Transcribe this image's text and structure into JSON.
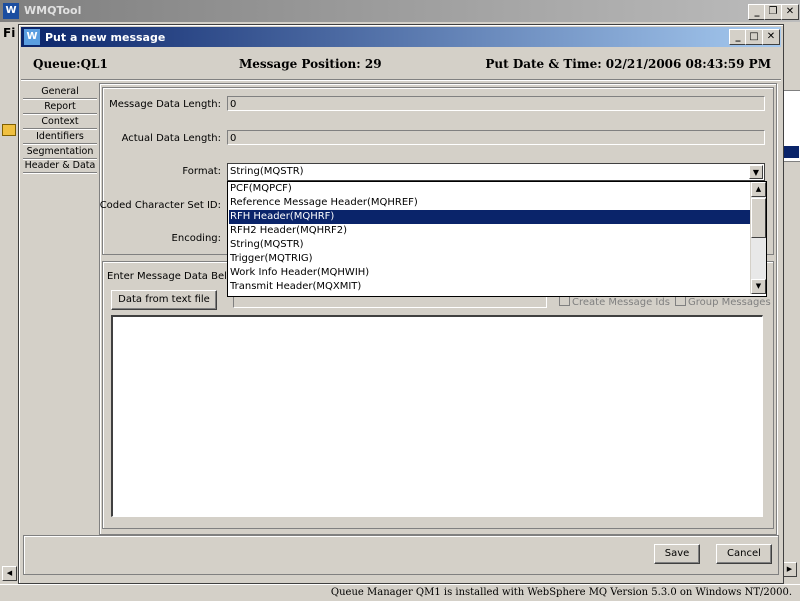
{
  "app": {
    "title": "WMQTool",
    "logo": "W",
    "menu_partial": "Fi",
    "status": "Queue Manager QM1  is installed with WebSphere MQ Version 5.3.0 on Windows NT/2000."
  },
  "dialog": {
    "title": "Put a new message",
    "logo": "W",
    "queue": "Queue:QL1",
    "position": "Message Position: 29",
    "datetime": "Put Date & Time: 02/21/2006 08:43:59 PM"
  },
  "tabs": [
    "General",
    "Report",
    "Context",
    "Identifiers",
    "Segmentation",
    "Header & Data"
  ],
  "form": {
    "msg_len_label": "Message Data Length:",
    "msg_len_value": "0",
    "actual_len_label": "Actual Data Length:",
    "actual_len_value": "0",
    "format_label": "Format:",
    "format_value": "String(MQSTR)",
    "ccsid_label": "Coded Character Set ID:",
    "encoding_label": "Encoding:"
  },
  "dropdown": {
    "options": [
      "PCF(MQPCF)",
      "Reference Message Header(MQHREF)",
      "RFH Header(MQHRF)",
      "RFH2 Header(MQHRF2)",
      "String(MQSTR)",
      "Trigger(MQTRIG)",
      "Work Info Header(MQHWIH)",
      "Transmit Header(MQXMIT)"
    ],
    "selected_index": 2
  },
  "data_section": {
    "label": "Enter Message Data Below",
    "from_file_button": "Data from text file",
    "create_ids": "Create Message Ids",
    "group_messages": "Group Messages"
  },
  "buttons": {
    "save": "Save",
    "cancel": "Cancel"
  },
  "window_controls": {
    "minimize": "_",
    "restore": "❐",
    "close": "✕"
  }
}
